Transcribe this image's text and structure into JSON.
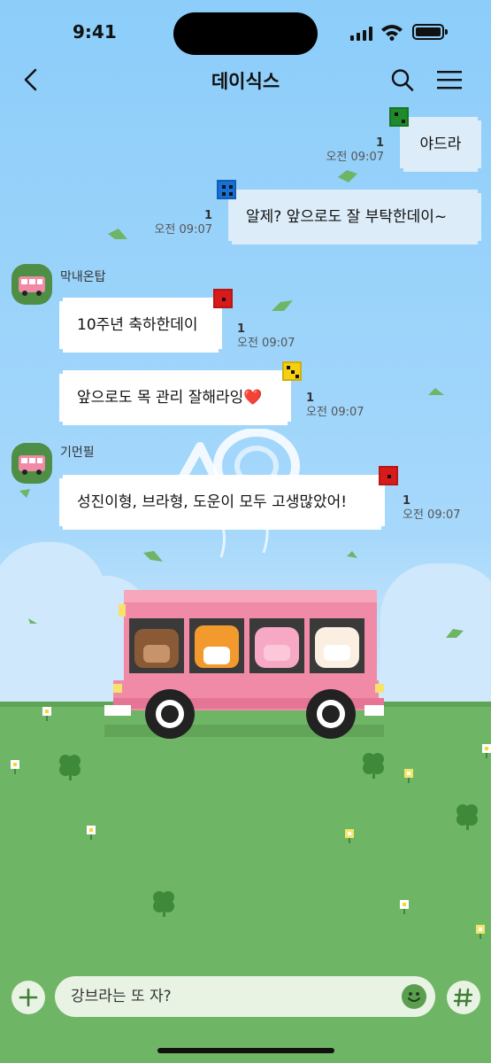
{
  "status": {
    "time": "9:41"
  },
  "header": {
    "title": "데이식스",
    "icons": {
      "back": "chevron-left-icon",
      "search": "search-icon",
      "menu": "hamburger-menu-icon"
    }
  },
  "messages": [
    {
      "side": "right",
      "text": "야드라",
      "unread": "1",
      "time": "오전 09:07",
      "dice": "green"
    },
    {
      "side": "right",
      "text": "알제? 앞으로도 잘 부탁한데이~",
      "unread": "1",
      "time": "오전 09:07",
      "dice": "blue"
    },
    {
      "side": "left",
      "sender": "막내온탑",
      "text": "10주년 축하한데이",
      "unread": "1",
      "time": "오전 09:07",
      "dice": "red"
    },
    {
      "side": "left",
      "text": "앞으로도 목 관리 잘해라잉❤️",
      "unread": "1",
      "time": "오전 09:07",
      "dice": "yellow"
    },
    {
      "side": "left",
      "sender": "기먼필",
      "text": "성진이형, 브라형, 도운이 모두 고생많았어!",
      "unread": "1",
      "time": "오전 09:07",
      "dice": "red"
    }
  ],
  "input": {
    "placeholder": "강브라는 또 자?"
  },
  "colors": {
    "sky": "#8ccdfa",
    "grass": "#6fb566",
    "bus": "#f08aa6",
    "dice_green": "#1d8a2c",
    "dice_blue": "#1670d6",
    "dice_red": "#d81a1a",
    "dice_yellow": "#f5cf10"
  }
}
